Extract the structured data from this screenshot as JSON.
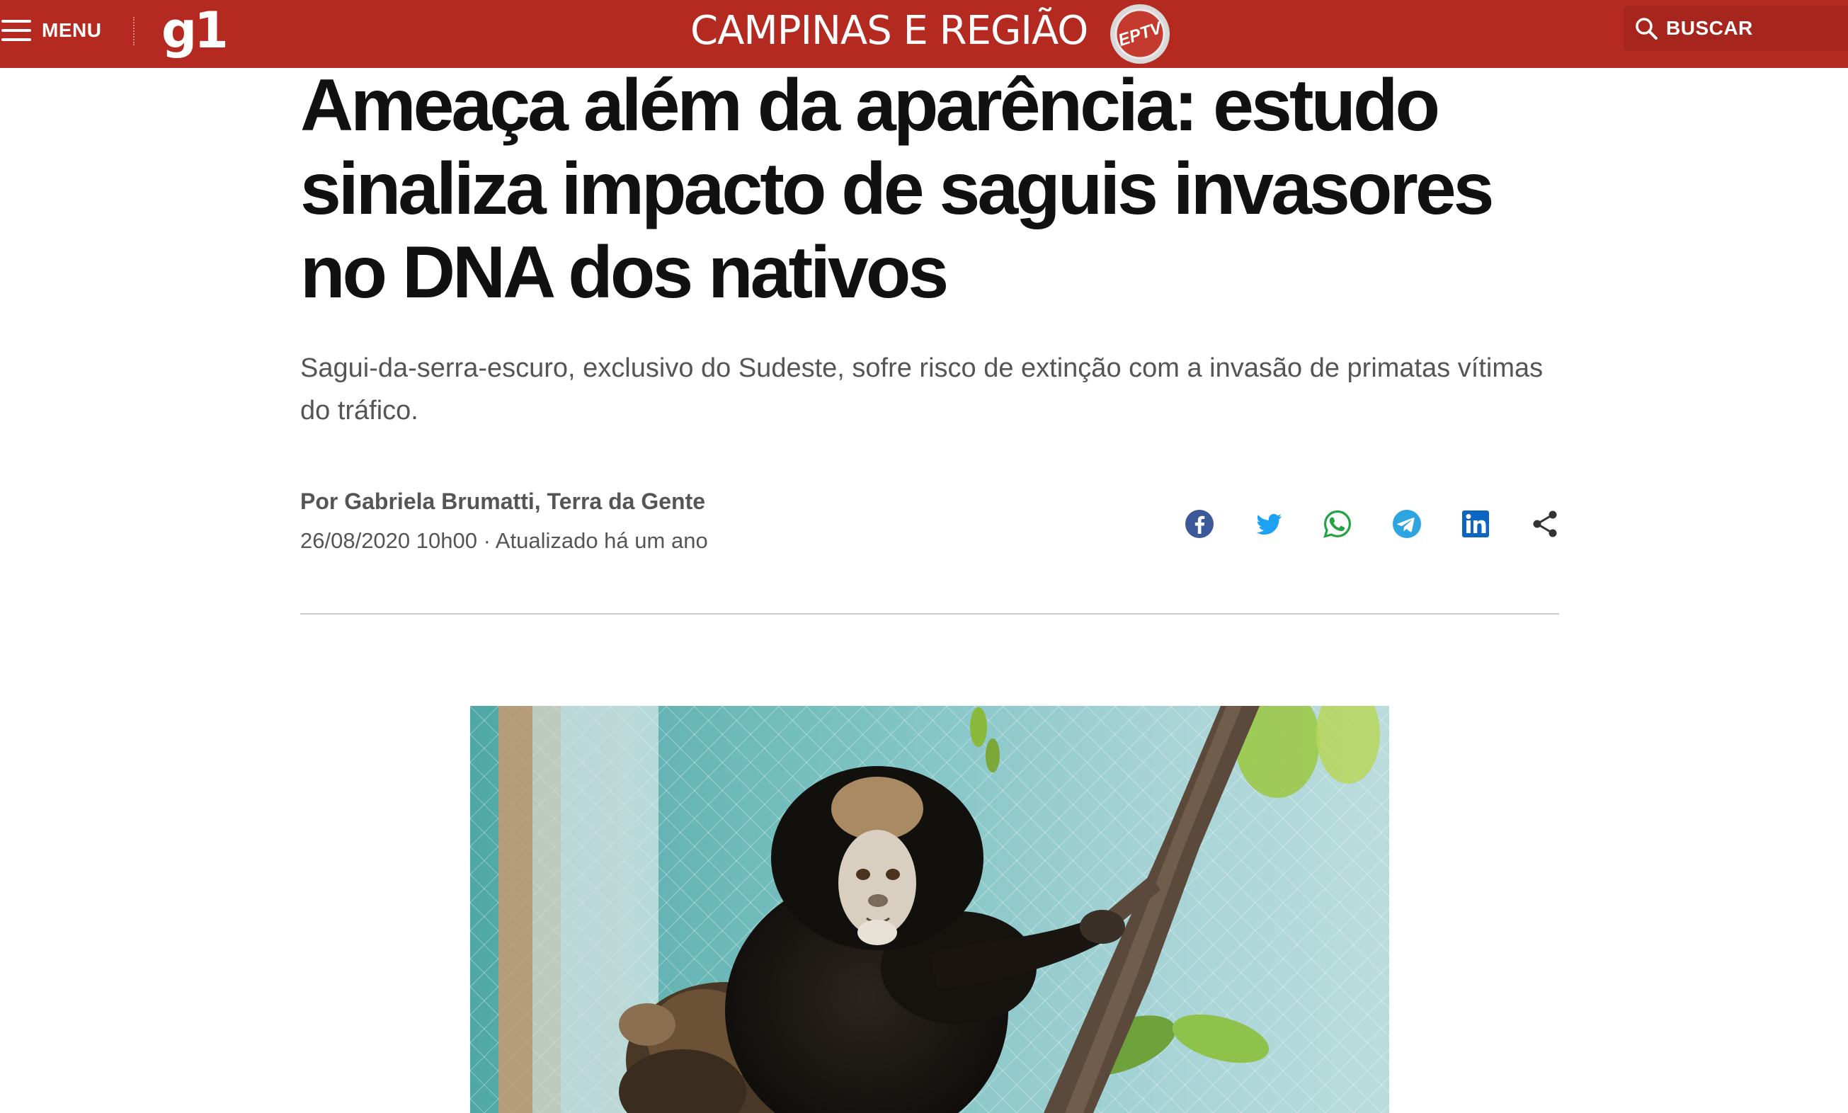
{
  "header": {
    "menu_label": "MENU",
    "logo_text": "g1",
    "region_title": "CAMPINAS E REGIÃO",
    "partner_logo_text": "EPTV",
    "search_label": "BUSCAR",
    "brand_color": "#b42a21"
  },
  "article": {
    "headline": "Ameaça além da aparência: estudo sinaliza impacto de saguis invasores no DNA dos nativos",
    "subtitle": "Sagui-da-serra-escuro, exclusivo do Sudeste, sofre risco de extinção com a invasão de primatas vítimas do tráfico.",
    "byline": "Por Gabriela Brumatti, Terra da Gente",
    "dateline": "26/08/2020 10h00 · Atualizado há um ano"
  },
  "share": {
    "icons": [
      {
        "name": "facebook-icon",
        "color": "#3b5998"
      },
      {
        "name": "twitter-icon",
        "color": "#1da1f2"
      },
      {
        "name": "whatsapp-icon",
        "color": "#25a244"
      },
      {
        "name": "telegram-icon",
        "color": "#2ca5e0"
      },
      {
        "name": "linkedin-icon",
        "color": "#0a66c2"
      },
      {
        "name": "share-icon",
        "color": "#333333"
      }
    ]
  },
  "photo": {
    "subject": "marmoset-on-branch-photo"
  }
}
